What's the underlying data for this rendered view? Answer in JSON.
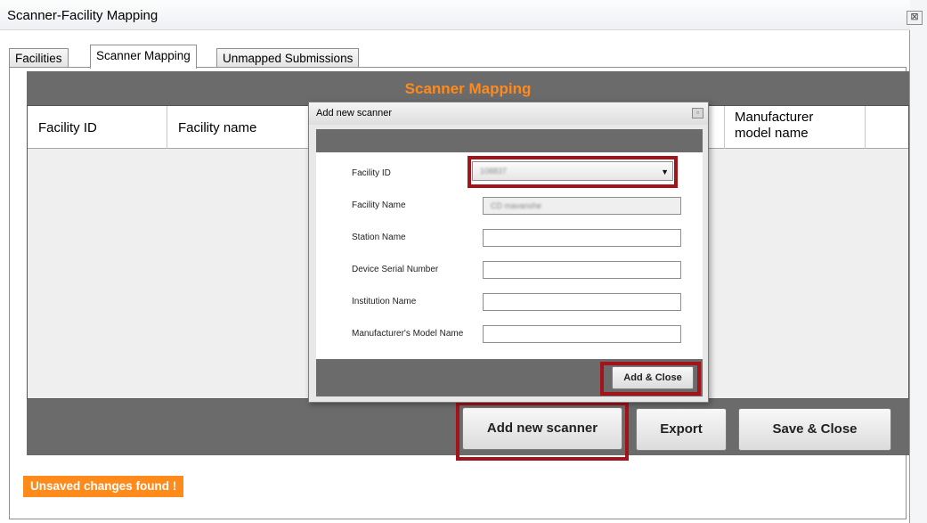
{
  "window": {
    "title": "Scanner-Facility Mapping",
    "close_glyph": "⊠"
  },
  "tabs": [
    {
      "label": "Facilities",
      "active": false
    },
    {
      "label": "Scanner Mapping",
      "active": true
    },
    {
      "label": "Unmapped Submissions",
      "active": false
    }
  ],
  "panel": {
    "title": "Scanner Mapping",
    "columns": [
      "Facility ID",
      "Facility name",
      "Manufacturer model name"
    ]
  },
  "buttons": {
    "add_new_scanner": "Add new scanner",
    "export": "Export",
    "save_close": "Save & Close"
  },
  "status": {
    "message": "Unsaved changes found !"
  },
  "dialog": {
    "title": "Add new scanner",
    "fields": {
      "facility_id": {
        "label": "Facility ID",
        "value": "108837"
      },
      "facility_name": {
        "label": "Facility Name",
        "value": "CD mavanshe"
      },
      "station_name": {
        "label": "Station Name",
        "value": ""
      },
      "device_serial": {
        "label": "Device Serial Number",
        "value": ""
      },
      "institution_name": {
        "label": "Institution Name",
        "value": ""
      },
      "model_name": {
        "label": "Manufacturer's Model Name",
        "value": ""
      }
    },
    "add_close": "Add & Close"
  },
  "colors": {
    "accent_orange": "#ff8a1c",
    "highlight_red": "#a4121a",
    "band_gray": "#6b6b6b"
  }
}
